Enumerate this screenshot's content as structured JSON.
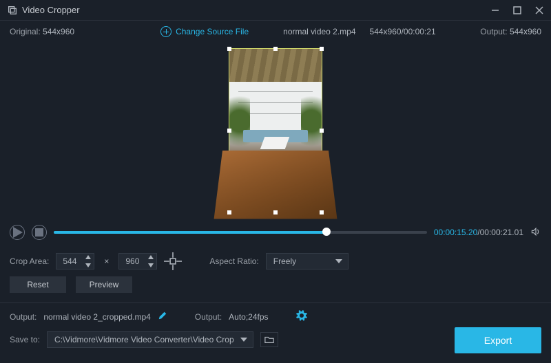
{
  "titlebar": {
    "app_name": "Video Cropper"
  },
  "info": {
    "original_label": "Original:",
    "original_res": "544x960",
    "change_source": "Change Source File",
    "filename": "normal video 2.mp4",
    "meta": "544x960/00:00:21",
    "output_label": "Output:",
    "output_res": "544x960"
  },
  "timeline": {
    "current": "00:00:15.20",
    "total": "00:00:21.01"
  },
  "crop": {
    "area_label": "Crop Area:",
    "width": "544",
    "height": "960",
    "mult": "×",
    "aspect_label": "Aspect Ratio:",
    "aspect_value": "Freely"
  },
  "buttons": {
    "reset": "Reset",
    "preview": "Preview",
    "export": "Export"
  },
  "output": {
    "label": "Output:",
    "filename": "normal video 2_cropped.mp4",
    "fmt_label": "Output:",
    "fmt_value": "Auto;24fps"
  },
  "save": {
    "label": "Save to:",
    "path": "C:\\Vidmore\\Vidmore Video Converter\\Video Crop"
  }
}
